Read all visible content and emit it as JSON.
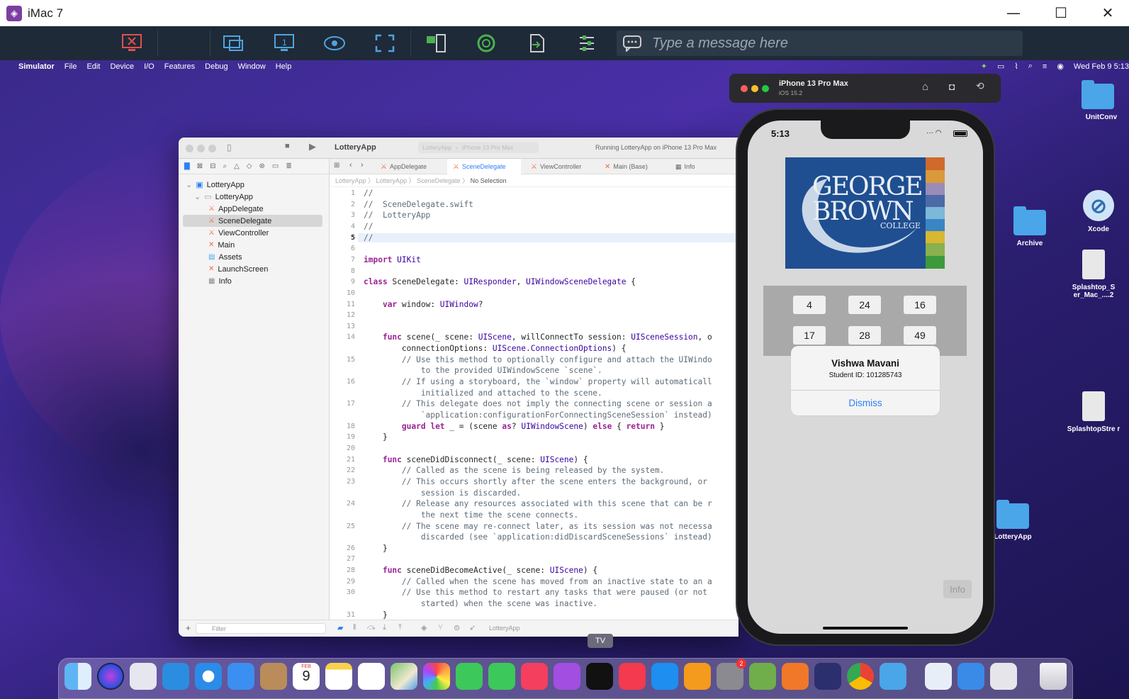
{
  "host": {
    "title": "iMac 7",
    "minimize": "—",
    "maximize": "☐",
    "close": "✕"
  },
  "toolbar": {
    "message_placeholder": "Type a message here"
  },
  "menubar": {
    "app": "Simulator",
    "items": [
      "File",
      "Edit",
      "Device",
      "I/O",
      "Features",
      "Debug",
      "Window",
      "Help"
    ],
    "datetime": "Wed Feb 9  5:13"
  },
  "desktop_icons": [
    {
      "label": "UnitConv"
    },
    {
      "label": "Xcode"
    },
    {
      "label": "Archive"
    },
    {
      "label": "Splashtop_S er_Mac_....2"
    },
    {
      "label": "SplashtopStre r"
    },
    {
      "label": "LotteryApp"
    }
  ],
  "xcode": {
    "project": "LotteryApp",
    "breadcrumb_scheme": "LotteryApp",
    "breadcrumb_device": "iPhone 13 Pro Max",
    "status": "Running LotteryApp on iPhone 13 Pro Max",
    "tabs": [
      "AppDelegate",
      "SceneDelegate",
      "ViewController",
      "Main (Base)",
      "Info"
    ],
    "jumpbar": [
      "LotteryApp",
      "LotteryApp",
      "SceneDelegate",
      "No Selection"
    ],
    "tree": [
      {
        "label": "LotteryApp"
      },
      {
        "label": "LotteryApp"
      },
      {
        "label": "AppDelegate"
      },
      {
        "label": "SceneDelegate"
      },
      {
        "label": "ViewController"
      },
      {
        "label": "Main"
      },
      {
        "label": "Assets"
      },
      {
        "label": "LaunchScreen"
      },
      {
        "label": "Info"
      }
    ],
    "filter_placeholder": "Filter",
    "bottom_scheme": "LotteryApp",
    "code": [
      {
        "n": "1",
        "t": "//"
      },
      {
        "n": "2",
        "t": "//  SceneDelegate.swift"
      },
      {
        "n": "3",
        "t": "//  LotteryApp"
      },
      {
        "n": "4",
        "t": "//"
      },
      {
        "n": "5",
        "t": "//"
      },
      {
        "n": "6",
        "t": ""
      },
      {
        "n": "7",
        "t": "import UIKit"
      },
      {
        "n": "8",
        "t": ""
      },
      {
        "n": "9",
        "t": "class SceneDelegate: UIResponder, UIWindowSceneDelegate {"
      },
      {
        "n": "10",
        "t": ""
      },
      {
        "n": "11",
        "t": "    var window: UIWindow?"
      },
      {
        "n": "12",
        "t": ""
      },
      {
        "n": "13",
        "t": ""
      },
      {
        "n": "14",
        "t": "    func scene(_ scene: UIScene, willConnectTo session: UISceneSession, o"
      },
      {
        "n": "",
        "t": "        connectionOptions: UIScene.ConnectionOptions) {"
      },
      {
        "n": "15",
        "t": "        // Use this method to optionally configure and attach the UIWindo"
      },
      {
        "n": "",
        "t": "            to the provided UIWindowScene `scene`."
      },
      {
        "n": "16",
        "t": "        // If using a storyboard, the `window` property will automaticall"
      },
      {
        "n": "",
        "t": "            initialized and attached to the scene."
      },
      {
        "n": "17",
        "t": "        // This delegate does not imply the connecting scene or session a"
      },
      {
        "n": "",
        "t": "            `application:configurationForConnectingSceneSession` instead)"
      },
      {
        "n": "18",
        "t": "        guard let _ = (scene as? UIWindowScene) else { return }"
      },
      {
        "n": "19",
        "t": "    }"
      },
      {
        "n": "20",
        "t": ""
      },
      {
        "n": "21",
        "t": "    func sceneDidDisconnect(_ scene: UIScene) {"
      },
      {
        "n": "22",
        "t": "        // Called as the scene is being released by the system."
      },
      {
        "n": "23",
        "t": "        // This occurs shortly after the scene enters the background, or"
      },
      {
        "n": "",
        "t": "            session is discarded."
      },
      {
        "n": "24",
        "t": "        // Release any resources associated with this scene that can be r"
      },
      {
        "n": "",
        "t": "            the next time the scene connects."
      },
      {
        "n": "25",
        "t": "        // The scene may re-connect later, as its session was not necessa"
      },
      {
        "n": "",
        "t": "            discarded (see `application:didDiscardSceneSessions` instead)"
      },
      {
        "n": "26",
        "t": "    }"
      },
      {
        "n": "27",
        "t": ""
      },
      {
        "n": "28",
        "t": "    func sceneDidBecomeActive(_ scene: UIScene) {"
      },
      {
        "n": "29",
        "t": "        // Called when the scene has moved from an inactive state to an a"
      },
      {
        "n": "30",
        "t": "        // Use this method to restart any tasks that were paused (or not"
      },
      {
        "n": "",
        "t": "            started) when the scene was inactive."
      },
      {
        "n": "31",
        "t": "    }"
      }
    ]
  },
  "simulator": {
    "device": "iPhone 13 Pro Max",
    "os": "iOS 15.2",
    "time": "5:13",
    "logo_line1": "GEORGE",
    "logo_line2": "BROWN",
    "logo_line3": "COLLEGE",
    "numbers": [
      "4",
      "24",
      "16",
      "17",
      "28",
      "49"
    ],
    "alert_name": "Vishwa Mavani",
    "alert_id": "Student ID: 101285743",
    "alert_button": "Dismiss",
    "info_button": "Info"
  },
  "dock": {
    "tooltip": "TV",
    "calendar_month": "FEB",
    "calendar_day": "9",
    "settings_badge": "2"
  },
  "colors": {
    "accent": "#2d7ff9",
    "logo_blue": "#1f4f91",
    "toolbar": "#1e2a37"
  }
}
